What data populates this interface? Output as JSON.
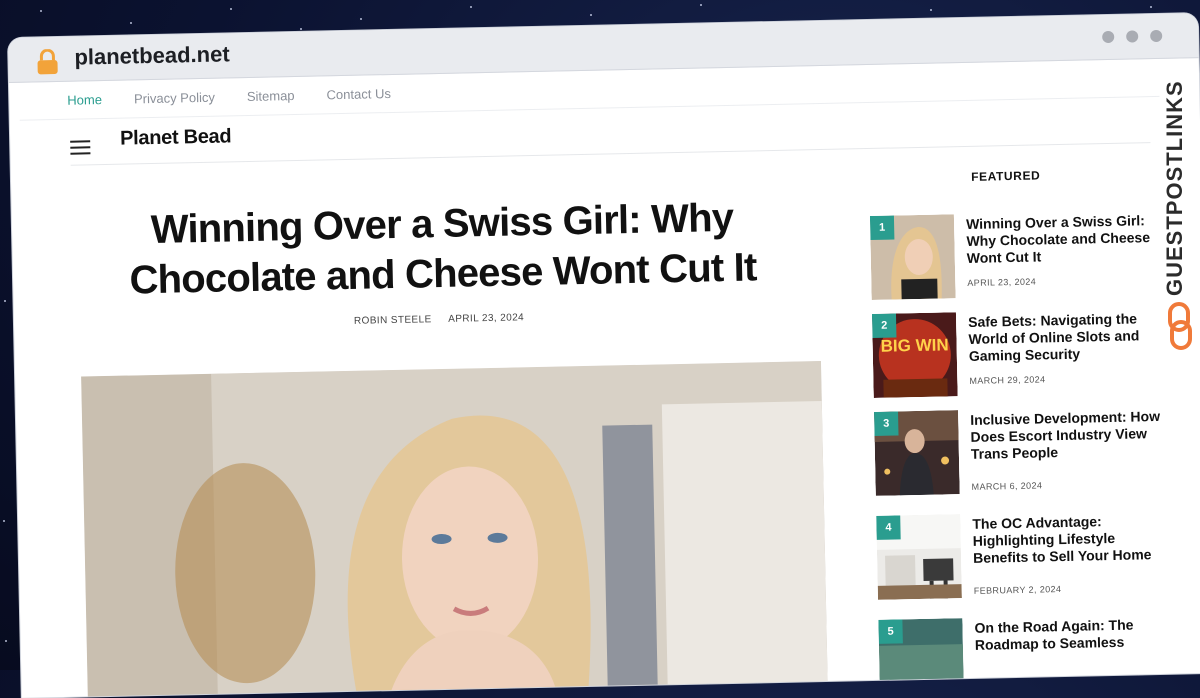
{
  "browser": {
    "url": "planetbead.net"
  },
  "nav": {
    "items": [
      "Home",
      "Privacy Policy",
      "Sitemap",
      "Contact Us"
    ]
  },
  "site": {
    "brand": "Planet Bead"
  },
  "article": {
    "title": "Winning Over a Swiss Girl: Why Chocolate and Cheese Wont Cut It",
    "author": "ROBIN STEELE",
    "date": "APRIL 23, 2024"
  },
  "sidebar": {
    "featured_label": "FEATURED",
    "items": [
      {
        "num": "1",
        "title": "Winning Over a Swiss Girl: Why Chocolate and Cheese Wont Cut It",
        "date": "APRIL 23, 2024"
      },
      {
        "num": "2",
        "title": "Safe Bets: Navigating the World of Online Slots and Gaming Security",
        "date": "MARCH 29, 2024",
        "thumb_text": "BIG WIN"
      },
      {
        "num": "3",
        "title": "Inclusive Development: How Does Escort Industry View Trans People",
        "date": "MARCH 6, 2024"
      },
      {
        "num": "4",
        "title": "The OC Advantage: Highlighting Lifestyle Benefits to Sell Your Home",
        "date": "FEBRUARY 2, 2024"
      },
      {
        "num": "5",
        "title": "On the Road Again: The Roadmap to Seamless",
        "date": ""
      }
    ]
  },
  "badge": {
    "text": "GUESTPOSTLINKS"
  },
  "colors": {
    "accent": "#2a9d8f",
    "badge_orange": "#f07a3a"
  }
}
